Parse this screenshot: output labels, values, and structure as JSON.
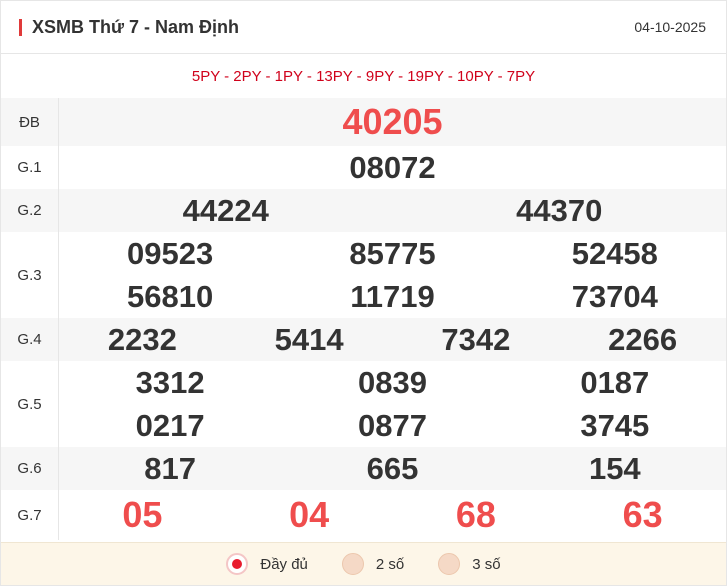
{
  "header": {
    "title": "XSMB Thứ 7 - Nam Định",
    "date": "04-10-2025"
  },
  "codes": "5PY - 2PY - 1PY - 13PY - 9PY - 19PY - 10PY - 7PY",
  "prizes": {
    "db": {
      "label": "ĐB",
      "values": [
        "40205"
      ]
    },
    "g1": {
      "label": "G.1",
      "values": [
        "08072"
      ]
    },
    "g2": {
      "label": "G.2",
      "values": [
        "44224",
        "44370"
      ]
    },
    "g3": {
      "label": "G.3",
      "values": [
        "09523",
        "85775",
        "52458",
        "56810",
        "11719",
        "73704"
      ]
    },
    "g4": {
      "label": "G.4",
      "values": [
        "2232",
        "5414",
        "7342",
        "2266"
      ]
    },
    "g5": {
      "label": "G.5",
      "values": [
        "3312",
        "0839",
        "0187",
        "0217",
        "0877",
        "3745"
      ]
    },
    "g6": {
      "label": "G.6",
      "values": [
        "817",
        "665",
        "154"
      ]
    },
    "g7": {
      "label": "G.7",
      "values": [
        "05",
        "04",
        "68",
        "63"
      ]
    }
  },
  "footer": {
    "options": [
      {
        "label": "Đầy đủ",
        "selected": true
      },
      {
        "label": "2 số",
        "selected": false
      },
      {
        "label": "3 số",
        "selected": false
      }
    ]
  },
  "colors": {
    "accent": "#e03a3a",
    "highlight": "#ef4d4d",
    "codes": "#d0021b",
    "footer_bg": "#fdf6e8"
  }
}
